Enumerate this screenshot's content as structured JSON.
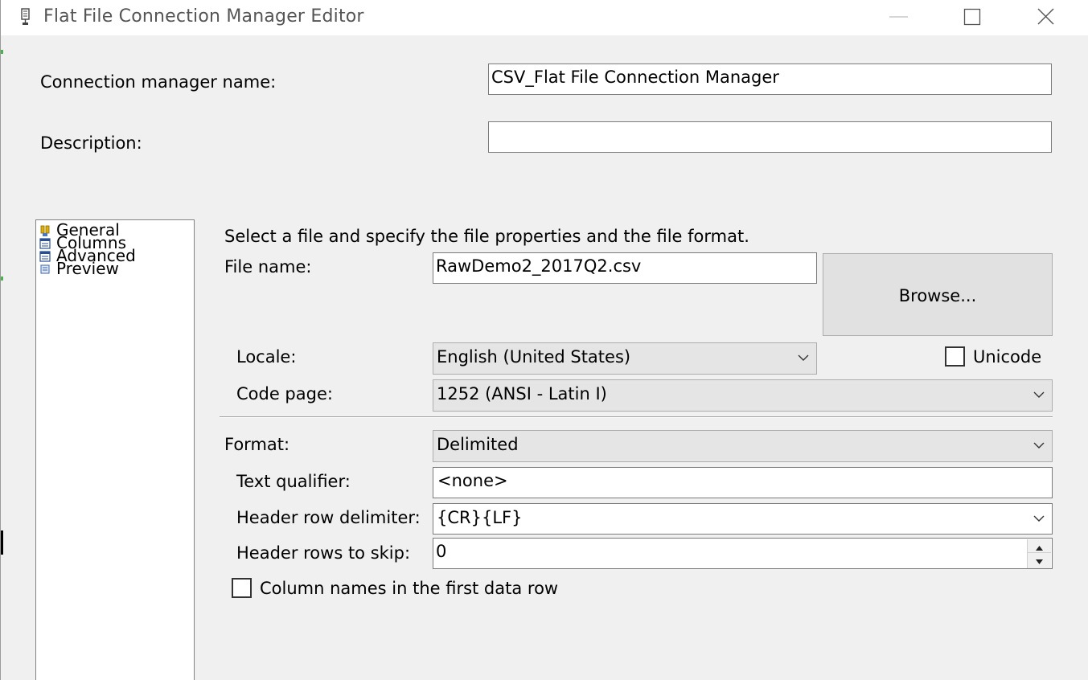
{
  "window": {
    "title": "Flat File Connection Manager Editor",
    "icons": {
      "app": "flat-file-icon",
      "minimize": "minimize-icon",
      "maximize": "maximize-icon",
      "close": "close-icon"
    }
  },
  "header": {
    "connection_name_label": "Connection manager name:",
    "connection_name_value": "CSV_Flat File Connection Manager",
    "description_label": "Description:",
    "description_value": ""
  },
  "nav": {
    "items": [
      {
        "label": "General",
        "icon": "general-page-icon"
      },
      {
        "label": "Columns",
        "icon": "columns-page-icon"
      },
      {
        "label": "Advanced",
        "icon": "advanced-page-icon"
      },
      {
        "label": "Preview",
        "icon": "preview-page-icon"
      }
    ]
  },
  "general": {
    "instruction": "Select a file and specify the file properties and the file format.",
    "file_name_label": "File name:",
    "file_name_value": "RawDemo2_2017Q2.csv",
    "browse_label": "Browse...",
    "locale_label": "Locale:",
    "locale_value": "English (United States)",
    "unicode_label": "Unicode",
    "unicode_checked": false,
    "code_page_label": "Code page:",
    "code_page_value": "1252  (ANSI - Latin I)",
    "format_label": "Format:",
    "format_value": "Delimited",
    "text_qualifier_label": "Text qualifier:",
    "text_qualifier_value": "<none>",
    "header_row_delimiter_label": "Header row delimiter:",
    "header_row_delimiter_value": "{CR}{LF}",
    "header_rows_to_skip_label": "Header rows to skip:",
    "header_rows_to_skip_value": "0",
    "column_names_label": "Column names in the first data row",
    "column_names_checked": false
  },
  "colors": {
    "window_bg": "#f0f0f0",
    "titlebar_bg": "#ffffff",
    "input_border": "#7a7a7a",
    "combo_bg": "#e5e5e5",
    "button_bg": "#e1e1e1"
  }
}
